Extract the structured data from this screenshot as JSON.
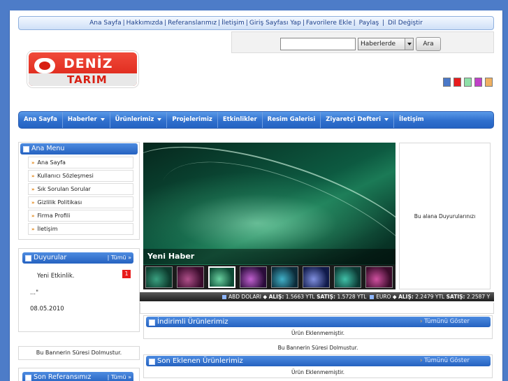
{
  "top_links": [
    "Ana Sayfa",
    "Hakkımızda",
    "Referanslarımız",
    "İletişim",
    "Giriş Sayfası Yap",
    "Favorilere Ekle",
    "Paylaş",
    "Dil Değiştir"
  ],
  "logo": {
    "line1": "DENİZ",
    "line2": "TARIM"
  },
  "search": {
    "value": "",
    "select_value": "Haberlerde",
    "button": "Ara"
  },
  "theme_colors": [
    "#4a78c8",
    "#e81c1c",
    "#8ee0a8",
    "#c040c8",
    "#f0b060"
  ],
  "nav": [
    {
      "label": "Ana Sayfa",
      "dropdown": false
    },
    {
      "label": "Haberler",
      "dropdown": true
    },
    {
      "label": "Ürünlerimiz",
      "dropdown": true
    },
    {
      "label": "Projelerimiz",
      "dropdown": false
    },
    {
      "label": "Etkinlikler",
      "dropdown": false
    },
    {
      "label": "Resim Galerisi",
      "dropdown": false
    },
    {
      "label": "Ziyaretçi Defteri",
      "dropdown": true
    },
    {
      "label": "İletişim",
      "dropdown": false
    }
  ],
  "ana_menu": {
    "title": "Ana Menu",
    "items": [
      "Ana Sayfa",
      "Kullanıcı Sözleşmesi",
      "Sık Sorulan Sorular",
      "Gizlilik Politikası",
      "Firma Profili",
      "İletişim"
    ]
  },
  "duyurular": {
    "title": "Duyurular",
    "all": "| Tümü »",
    "item_title": "Yeni Etkinlik.",
    "badge": "1",
    "snippet": "...\"",
    "date": "08.05.2010"
  },
  "banner_left": "Bu Bannerin Süresi Dolmustur.",
  "son_ref": {
    "title": "Son Referansımız",
    "all": "| Tümü »"
  },
  "slider": {
    "caption": "Yeni Haber"
  },
  "announce_box": "Bu alana Duyurularınızı Ekleyiniz...",
  "ticker": {
    "usd_label": "ABD DOLARI",
    "alis": "ALIŞ:",
    "usd_alis": "1.5663 YTL",
    "satis": "SATIŞ:",
    "usd_satis": "1.5728 YTL",
    "eur_label": "EURO",
    "eur_alis": "2.2479 YTL",
    "eur_satis": "2.2587 Y"
  },
  "indirimli": {
    "title": "İndirimli Ürünlerimiz",
    "all": "Tümünü Göster",
    "msg": "Ürün Eklenmemiştir."
  },
  "banner_main": "Bu Bannerin Süresi Dolmustur.",
  "son_eklenen": {
    "title": "Son Eklenen Ürünlerimiz",
    "all": "Tümünü Göster",
    "msg": "Ürün Eklenmemiştir."
  }
}
